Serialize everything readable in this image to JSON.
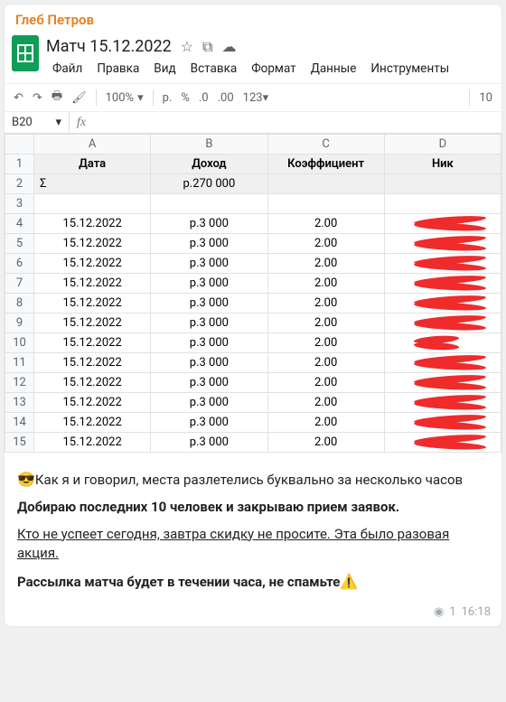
{
  "sender": "Глеб Петров",
  "doc": {
    "title": "Матч 15.12.2022",
    "menus": [
      "Файл",
      "Правка",
      "Вид",
      "Вставка",
      "Формат",
      "Данные",
      "Инструменты"
    ]
  },
  "toolbar": {
    "zoom": "100%",
    "currency": "р.",
    "percent": "%",
    "dec_dec": ".0",
    "dec_inc": ".00",
    "more_fmt": "123",
    "font_size": "10"
  },
  "namebox": "B20",
  "columns": [
    "A",
    "B",
    "C",
    "D"
  ],
  "headers": {
    "a": "Дата",
    "b": "Доход",
    "c": "Коэффициент",
    "d": "Ник"
  },
  "sum": {
    "label": "Σ",
    "value": "р.270 000"
  },
  "rows": [
    {
      "n": "4",
      "a": "15.12.2022",
      "b": "р.3 000",
      "c": "2.00",
      "d": ""
    },
    {
      "n": "5",
      "a": "15.12.2022",
      "b": "р.3 000",
      "c": "2.00",
      "d": ""
    },
    {
      "n": "6",
      "a": "15.12.2022",
      "b": "р.3 000",
      "c": "2.00",
      "d": ""
    },
    {
      "n": "7",
      "a": "15.12.2022",
      "b": "р.3 000",
      "c": "2.00",
      "d": ""
    },
    {
      "n": "8",
      "a": "15.12.2022",
      "b": "р.3 000",
      "c": "2.00",
      "d": ""
    },
    {
      "n": "9",
      "a": "15.12.2022",
      "b": "р.3 000",
      "c": "2.00",
      "d": ""
    },
    {
      "n": "10",
      "a": "15.12.2022",
      "b": "р.3 000",
      "c": "2.00",
      "d": ""
    },
    {
      "n": "11",
      "a": "15.12.2022",
      "b": "р.3 000",
      "c": "2.00",
      "d": ""
    },
    {
      "n": "12",
      "a": "15.12.2022",
      "b": "р.3 000",
      "c": "2.00",
      "d": ""
    },
    {
      "n": "13",
      "a": "15.12.2022",
      "b": "р.3 000",
      "c": "2.00",
      "d": ""
    },
    {
      "n": "14",
      "a": "15.12.2022",
      "b": "р.3 000",
      "c": "2.00",
      "d": ""
    },
    {
      "n": "15",
      "a": "15.12.2022",
      "b": "р.3 000",
      "c": "2.00",
      "d": ""
    }
  ],
  "caption": {
    "emoji": "😎",
    "line1": "Как я и говорил, места разлетелись буквально за несколько часов",
    "line2": "Добираю последних 10 человек и закрываю прием заявок.",
    "line3": "Кто не успеет сегодня, завтра скидку не просите. Эта было разовая акция.",
    "line4_a": "Рассылка матча будет в течении часа, не спамьте",
    "line4_emoji": "⚠️"
  },
  "meta": {
    "views": "1",
    "time": "16:18"
  }
}
